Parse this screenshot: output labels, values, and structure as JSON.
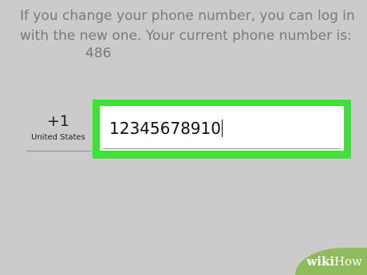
{
  "info": {
    "line1": "If you change your phone number, you can log in",
    "line2": "with the new one. Your current phone number is:",
    "current_number_suffix": "486"
  },
  "country": {
    "code": "+1",
    "name": "United States"
  },
  "phone_input": {
    "value": "12345678910"
  },
  "colors": {
    "highlight": "#3ee03a",
    "background": "#cbcbcb"
  },
  "watermark": {
    "part1": "wiki",
    "part2": "How"
  }
}
